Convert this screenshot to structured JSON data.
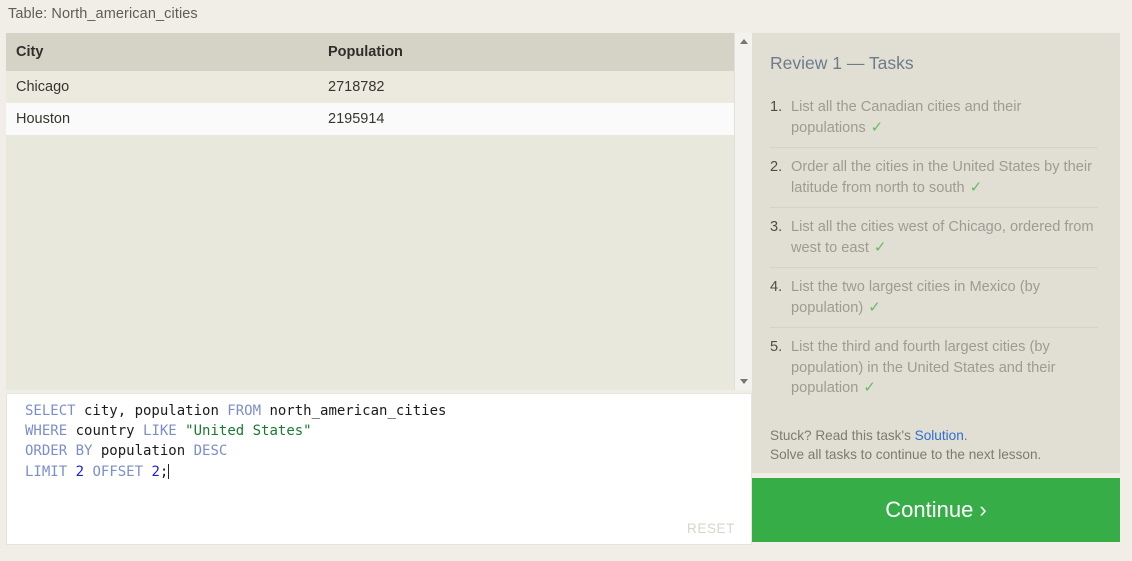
{
  "table": {
    "caption": "Table: North_american_cities",
    "columns": [
      "City",
      "Population"
    ],
    "rows": [
      {
        "city": "Chicago",
        "population": "2718782"
      },
      {
        "city": "Houston",
        "population": "2195914"
      }
    ]
  },
  "scrollbar": {
    "up_icon": "scroll-up-arrow-icon",
    "down_icon": "scroll-down-arrow-icon"
  },
  "editor": {
    "lines": [
      [
        {
          "t": "SELECT",
          "c": "kw"
        },
        {
          "t": " city, population ",
          "c": "id"
        },
        {
          "t": "FROM",
          "c": "kw"
        },
        {
          "t": " north_american_cities",
          "c": "id"
        }
      ],
      [
        {
          "t": "WHERE",
          "c": "kw"
        },
        {
          "t": " country ",
          "c": "id"
        },
        {
          "t": "LIKE",
          "c": "kw"
        },
        {
          "t": " ",
          "c": "id"
        },
        {
          "t": "\"United States\"",
          "c": "str"
        }
      ],
      [
        {
          "t": "ORDER",
          "c": "kw"
        },
        {
          "t": " ",
          "c": "id"
        },
        {
          "t": "BY",
          "c": "kw"
        },
        {
          "t": " population ",
          "c": "id"
        },
        {
          "t": "DESC",
          "c": "kw"
        }
      ],
      [
        {
          "t": "LIMIT",
          "c": "kw"
        },
        {
          "t": " ",
          "c": "id"
        },
        {
          "t": "2",
          "c": "num"
        },
        {
          "t": " ",
          "c": "id"
        },
        {
          "t": "OFFSET",
          "c": "kw"
        },
        {
          "t": " ",
          "c": "id"
        },
        {
          "t": "2",
          "c": "num"
        },
        {
          "t": ";",
          "c": "id"
        }
      ]
    ],
    "reset_label": "RESET"
  },
  "tasks": {
    "title": "Review 1 — Tasks",
    "check_glyph": "✓",
    "items": [
      {
        "text": "List all the Canadian cities and their populations",
        "done": true
      },
      {
        "text": "Order all the cities in the United States by their latitude from north to south",
        "done": true
      },
      {
        "text": "List all the cities west of Chicago, ordered from west to east",
        "done": true
      },
      {
        "text": "List the two largest cities in Mexico (by population)",
        "done": true
      },
      {
        "text": "List the third and fourth largest cities (by population) in the United States and their population",
        "done": true
      }
    ],
    "footer_prefix": "Stuck? Read this task's ",
    "footer_link": "Solution",
    "footer_suffix": ".",
    "footer_line2": "Solve all tasks to continue to the next lesson."
  },
  "continue": {
    "label": "Continue ›"
  },
  "colors": {
    "page_bg": "#f0eee7",
    "table_header_bg": "#d5d3c5",
    "task_panel_bg": "#e1dfd3",
    "continue_green": "#36ad47",
    "check_green": "#63bd63",
    "link_blue": "#2f6fd0",
    "keyword_blue": "#7c8ec9",
    "string_green": "#1a7a2e",
    "number_blue": "#1f1fd0"
  }
}
